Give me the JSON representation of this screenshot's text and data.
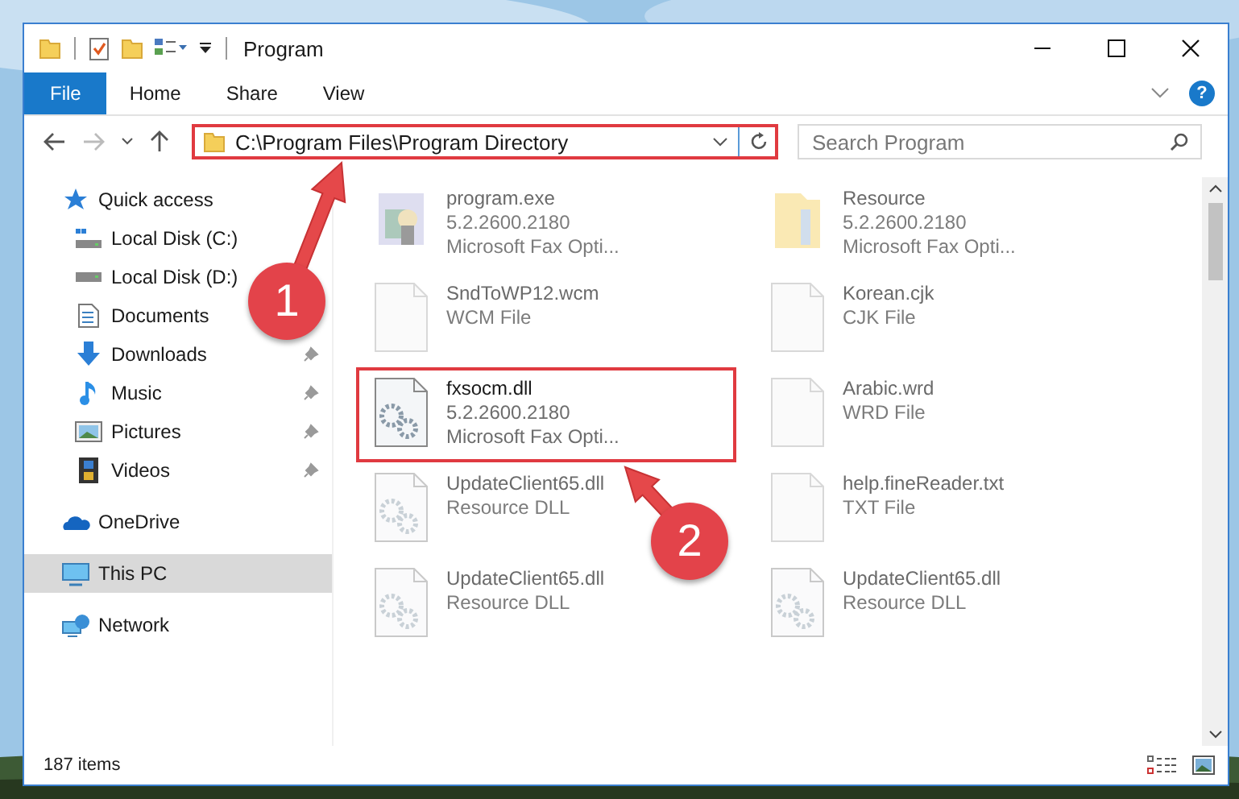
{
  "window": {
    "title": "Program"
  },
  "ribbon": {
    "tabs": [
      {
        "label": "File",
        "selected": true
      },
      {
        "label": "Home",
        "selected": false
      },
      {
        "label": "Share",
        "selected": false
      },
      {
        "label": "View",
        "selected": false
      }
    ],
    "help": "?"
  },
  "address": {
    "path": "C:\\Program Files\\Program Directory",
    "highlighted": true
  },
  "search": {
    "placeholder": "Search Program"
  },
  "sidebar": {
    "items": [
      {
        "label": "Quick access",
        "kind": "star",
        "selected": false,
        "children": [
          {
            "label": "Local Disk (C:)",
            "kind": "system-drive",
            "pinned": false,
            "selected": false
          },
          {
            "label": "Local Disk (D:)",
            "kind": "drive",
            "pinned": false,
            "selected": false
          },
          {
            "label": "Documents",
            "kind": "documents",
            "pinned": false,
            "selected": false
          },
          {
            "label": "Downloads",
            "kind": "downloads",
            "pinned": true,
            "selected": false
          },
          {
            "label": "Music",
            "kind": "music",
            "pinned": true,
            "selected": false
          },
          {
            "label": "Pictures",
            "kind": "pictures",
            "pinned": true,
            "selected": false
          },
          {
            "label": "Videos",
            "kind": "videos",
            "pinned": true,
            "selected": false
          }
        ]
      },
      {
        "label": "OneDrive",
        "kind": "cloud",
        "selected": false
      },
      {
        "label": "This PC",
        "kind": "computer",
        "selected": true
      },
      {
        "label": "Network",
        "kind": "network",
        "selected": false
      }
    ]
  },
  "files": [
    {
      "name": "program.exe",
      "details": [
        "5.2.2600.2180",
        "Microsoft  Fax Opti..."
      ],
      "kind": "app",
      "dimmed": true,
      "highlighted": false
    },
    {
      "name": "Resource",
      "details": [
        "5.2.2600.2180",
        "Microsoft  Fax Opti..."
      ],
      "kind": "folder",
      "dimmed": true,
      "highlighted": false
    },
    {
      "name": "SndToWP12.wcm",
      "details": [
        "WCM File"
      ],
      "kind": "file",
      "dimmed": true,
      "highlighted": false
    },
    {
      "name": "Korean.cjk",
      "details": [
        "CJK File"
      ],
      "kind": "file",
      "dimmed": true,
      "highlighted": false
    },
    {
      "name": "fxsocm.dll",
      "details": [
        "5.2.2600.2180",
        "Microsoft  Fax Opti..."
      ],
      "kind": "dll",
      "dimmed": false,
      "highlighted": true
    },
    {
      "name": "Arabic.wrd",
      "details": [
        "WRD File"
      ],
      "kind": "file",
      "dimmed": true,
      "highlighted": false
    },
    {
      "name": "UpdateClient65.dll",
      "details": [
        "Resource DLL"
      ],
      "kind": "dll",
      "dimmed": true,
      "highlighted": false
    },
    {
      "name": "help.fineReader.txt",
      "details": [
        "TXT File"
      ],
      "kind": "file",
      "dimmed": true,
      "highlighted": false
    },
    {
      "name": "UpdateClient65.dll",
      "details": [
        "Resource DLL"
      ],
      "kind": "dll",
      "dimmed": true,
      "highlighted": false
    },
    {
      "name": "UpdateClient65.dll",
      "details": [
        "Resource DLL"
      ],
      "kind": "dll",
      "dimmed": true,
      "highlighted": false
    }
  ],
  "status_bar": {
    "count": "187 items"
  },
  "callouts": [
    {
      "number": "1"
    },
    {
      "number": "2"
    }
  ]
}
